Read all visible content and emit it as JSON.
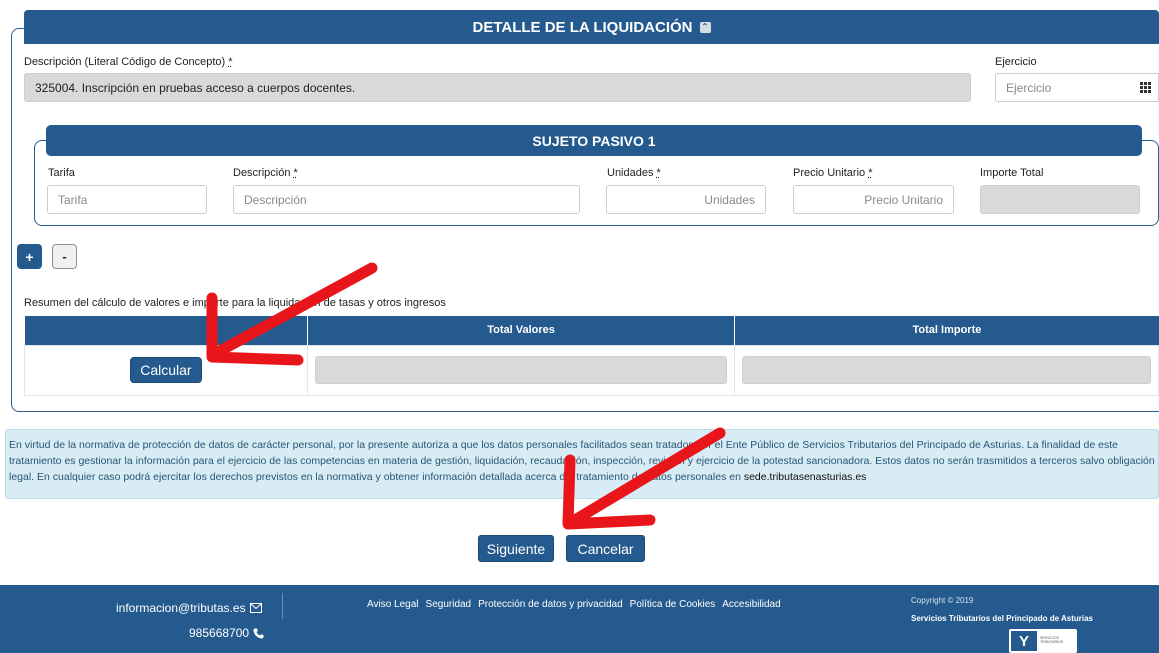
{
  "detail": {
    "title": "DETALLE DE LA LIQUIDACIÓN",
    "descripcion_label": "Descripción (Literal Código de Concepto)",
    "req_mark": "*",
    "descripcion_value": "325004. Inscripción en pruebas acceso a cuerpos docentes.",
    "ejercicio_label": "Ejercicio",
    "ejercicio_placeholder": "Ejercicio"
  },
  "sujeto": {
    "title": "SUJETO PASIVO 1",
    "tarifa_label": "Tarifa",
    "tarifa_placeholder": "Tarifa",
    "descripcion_label": "Descripción",
    "descripcion_placeholder": "Descripción",
    "unidades_label": "Unidades",
    "unidades_placeholder": "Unidades",
    "precio_label": "Precio Unitario",
    "precio_placeholder": "Precio Unitario",
    "importe_label": "Importe Total"
  },
  "buttons": {
    "add": "+",
    "remove": "-",
    "calcular": "Calcular",
    "siguiente": "Siguiente",
    "cancelar": "Cancelar"
  },
  "summary": {
    "caption": "Resumen del cálculo de valores e importe para la liquidación de tasas y otros ingresos",
    "col_total_valores": "Total Valores",
    "col_total_importe": "Total Importe"
  },
  "notice": {
    "text": "En virtud de la normativa de protección de datos de carácter personal, por la presente autoriza a que los datos personales facilitados sean tratados por el Ente Público de Servicios Tributarios del Principado de Asturias. La finalidad de este tratamiento es gestionar la información para el ejercicio de las competencias en materia de gestión, liquidación, recaudación, inspección, revisión y ejercicio de la potestad sancionadora. Estos datos no serán trasmitidos a terceros salvo obligación legal. En cualquier caso podrá ejercitar los derechos previstos en la normativa y obtener información detallada acerca del tratamiento de datos personales en ",
    "link": "sede.tributasenasturias.es"
  },
  "footer": {
    "email": "informacion@tributas.es",
    "phone": "985668700",
    "links": [
      "Aviso Legal",
      "Seguridad",
      "Protección de datos y privacidad",
      "Política de Cookies",
      "Accesibilidad"
    ],
    "copyright": "Copyright © 2019",
    "org": "Servicios Tributarios del Principado de Asturias",
    "logo_text": "SERVICIOS TRIBUTARIOS"
  },
  "colors": {
    "primary": "#245a8d",
    "readonly_field": "#d9d9d9",
    "notice_bg": "#d7ecf5",
    "annotation": "#e8151b"
  },
  "icons": [
    "chevron-up-icon",
    "grid-icon",
    "envelope-icon",
    "phone-icon",
    "red-arrow-annotation"
  ]
}
